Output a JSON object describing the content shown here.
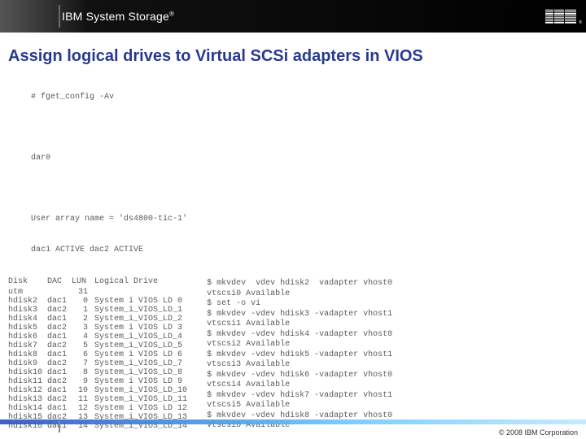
{
  "header": {
    "product": "IBM System Storage",
    "reg": "®",
    "logo_alt": "IBM"
  },
  "title": "Assign logical drives to Virtual SCSi adapters in VIOS",
  "left": {
    "cmd": "# fget_config -Av",
    "dar": "dar0",
    "uarray": "User array name = 'ds4800-tic-1'",
    "dac": "dac1 ACTIVE dac2 ACTIVE",
    "cols": {
      "c1": "Disk",
      "c2": "DAC",
      "c3": "LUN",
      "c4": "Logical Drive"
    },
    "rows": [
      {
        "disk": "utm",
        "dac": "",
        "lun": "31",
        "ld": ""
      },
      {
        "disk": "hdisk2",
        "dac": "dac1",
        "lun": "0",
        "ld": "System i VIOS LD 0"
      },
      {
        "disk": "hdisk3",
        "dac": "dac2",
        "lun": "1",
        "ld": "System_i_VIOS_LD_1"
      },
      {
        "disk": "hdisk4",
        "dac": "dac1",
        "lun": "2",
        "ld": "System_i_VIOS_LD_2"
      },
      {
        "disk": "hdisk5",
        "dac": "dac2",
        "lun": "3",
        "ld": "System i VIOS LD 3"
      },
      {
        "disk": "hdisk6",
        "dac": "dac1",
        "lun": "4",
        "ld": "System_i_VIOS_LD_4"
      },
      {
        "disk": "hdisk7",
        "dac": "dac2",
        "lun": "5",
        "ld": "System_i_VIOS_LD_5"
      },
      {
        "disk": "hdisk8",
        "dac": "dac1",
        "lun": "6",
        "ld": "System i VIOS LD 6"
      },
      {
        "disk": "hdisk9",
        "dac": "dac2",
        "lun": "7",
        "ld": "System_i_VIOS_LD_7"
      },
      {
        "disk": "hdisk10",
        "dac": "dac1",
        "lun": "8",
        "ld": "System_i_VIOS_LD_8"
      },
      {
        "disk": "hdisk11",
        "dac": "dac2",
        "lun": "9",
        "ld": "System i VIOS LD 9"
      },
      {
        "disk": "hdisk12",
        "dac": "dac1",
        "lun": "10",
        "ld": "System_i_VIOS_LD_10"
      },
      {
        "disk": "hdisk13",
        "dac": "dac2",
        "lun": "11",
        "ld": "System_i_VIOS_LD_11"
      },
      {
        "disk": "hdisk14",
        "dac": "dac1",
        "lun": "12",
        "ld": "System i VIOS LD 12"
      },
      {
        "disk": "hdisk15",
        "dac": "dac2",
        "lun": "13",
        "ld": "System_i_VIOS_LD_13"
      },
      {
        "disk": "hdisk16",
        "dac": "dac1",
        "lun": "14",
        "ld": "System_i_VIOS_LD_14"
      }
    ]
  },
  "right": {
    "lines": [
      "$ mkvdev  vdev hdisk2  vadapter vhost0",
      "vtscsi0 Available",
      "$ set -o vi",
      "$ mkvdev -vdev hdisk3 -vadapter vhost1",
      "vtscsi1 Available",
      "$ mkvdev -vdev hdisk4 -vadapter vhost0",
      "vtscsi2 Available",
      "$ mkvdev -vdev hdisk5 -vadapter vhost1",
      "vtscsi3 Available",
      "$ mkvdev -vdev hdisk6 -vadapter vhost0",
      "vtscsi4 Available",
      "$ mkvdev -vdev hdisk7 -vadapter vhost1",
      "vtscsi5 Available",
      "$ mkvdev -vdev hdisk8 -vadapter vhost0",
      "vtscsi6 Available"
    ]
  },
  "footer": {
    "copyright": "© 2008 IBM Corporation"
  }
}
